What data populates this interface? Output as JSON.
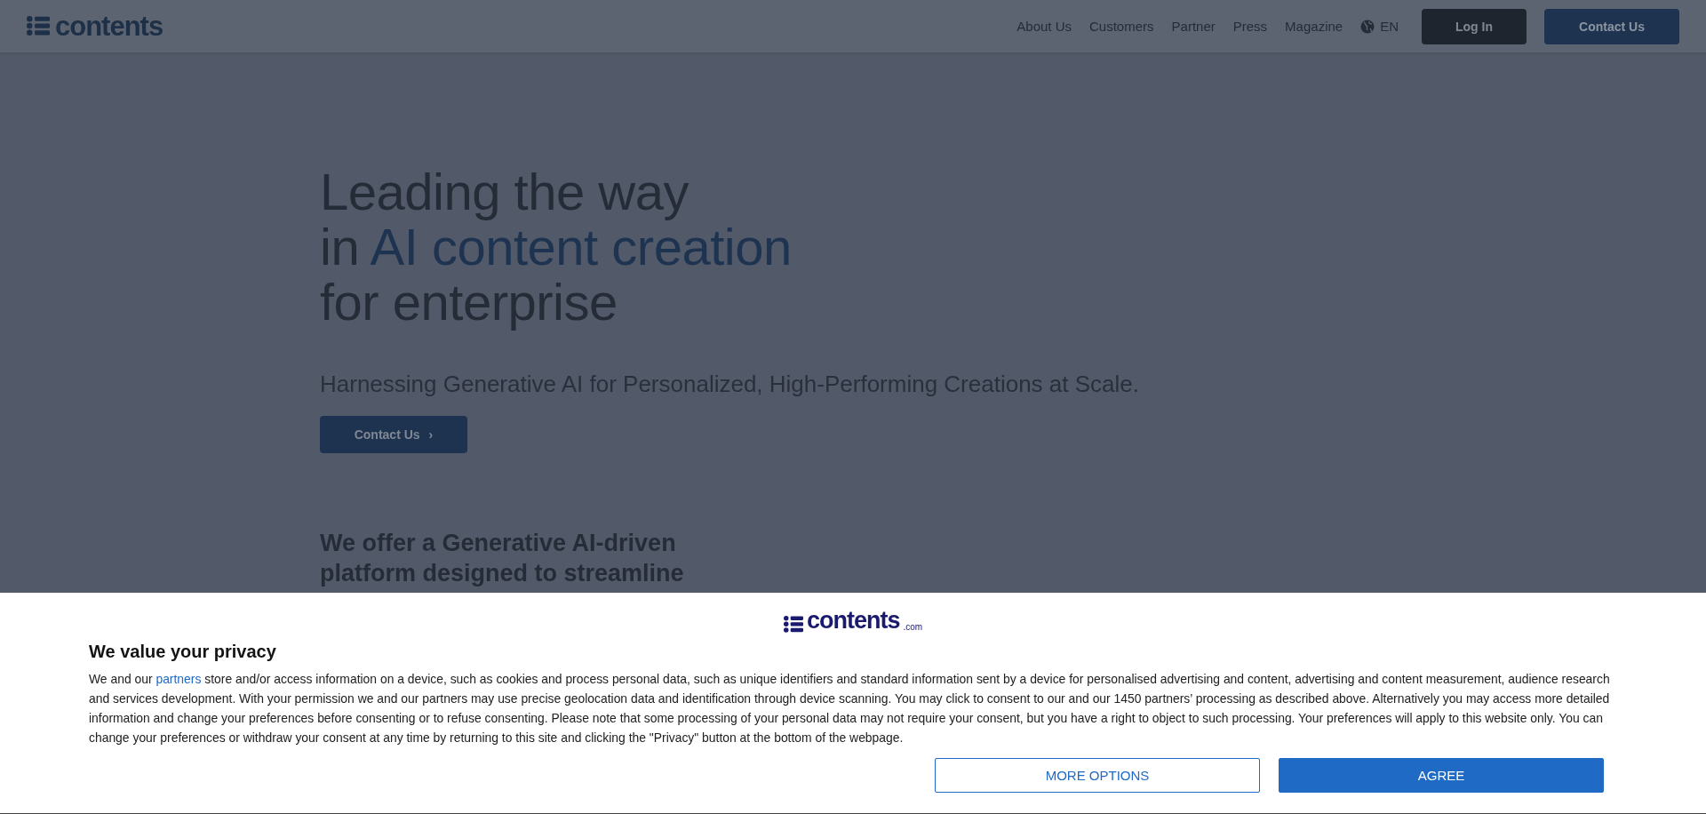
{
  "header": {
    "logo": "contents",
    "nav": [
      "About Us",
      "Customers",
      "Partner",
      "Press",
      "Magazine"
    ],
    "language": "EN",
    "buttons": [
      {
        "label": "Log In",
        "kind": "dark"
      },
      {
        "label": "Contact Us",
        "kind": "primary"
      }
    ]
  },
  "hero": {
    "headline": [
      {
        "before": "Leading the way"
      },
      {
        "before": "in ",
        "accent": "AI content creation"
      },
      {
        "before": "for enterprise"
      }
    ],
    "subtitle": "Harnessing Generative AI for Personalized, High-Performing Creations at Scale.",
    "cta": "Contact Us",
    "cta_arrow": "›",
    "intro": [
      "We offer a Generative AI-driven",
      "platform designed to streamline"
    ]
  },
  "consent": {
    "logo": "contents",
    "logo_suffix": ".com",
    "title": "We value your privacy",
    "text_before": "We and our ",
    "link": "partners",
    "text_after": " store and/or access information on a device, such as cookies and process personal data, such as unique identifiers and standard information sent by a device for personalised advertising and content, advertising and content measurement, audience research and services development. With your permission we and our partners may use precise geolocation data and identification through device scanning. You may click to consent to our and our 1450 partners’ processing as described above. Alternatively you may access more detailed information and change your preferences before consenting or to refuse consenting. Please note that some processing of your personal data may not require your consent, but you have a right to object to such processing. Your preferences will apply to this website only. You can change your preferences or withdraw your consent at any time by returning to this site and clicking the \"Privacy\" button at the bottom of the webpage.",
    "buttons": [
      {
        "label": "MORE OPTIONS",
        "kind": "outline"
      },
      {
        "label": "AGREE",
        "kind": "primary"
      }
    ]
  }
}
